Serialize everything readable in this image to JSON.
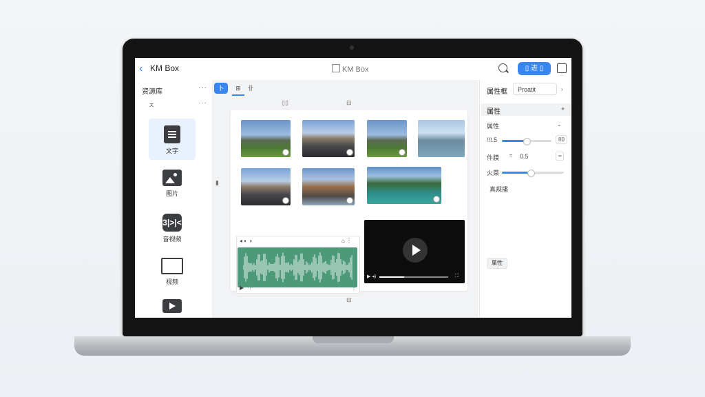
{
  "header": {
    "back_icon": "chevron-left-icon",
    "app_title": "KM Box",
    "center_title": "KM Box",
    "primary_button": "▯ 进 ▯",
    "search_icon": "search-icon",
    "share_icon": "share-icon",
    "accent_color": "#3a86ef"
  },
  "sidebar": {
    "title": "资源库",
    "more": "···",
    "sub": "ㅈ",
    "items": [
      {
        "label": "文字",
        "icon": "document-icon"
      },
      {
        "label": "图片",
        "icon": "image-icon"
      },
      {
        "label": "音视频",
        "icon": "audio-icon",
        "glyph": "3|>|<"
      },
      {
        "label": "视频",
        "icon": "monitor-icon"
      },
      {
        "label": "",
        "icon": "video-icon"
      }
    ]
  },
  "canvas": {
    "toolbar": [
      "卜",
      "⊞",
      "卝"
    ],
    "top_icons": [
      "▯▯",
      "⊟"
    ],
    "bottom_icon": "⊟",
    "side_icon": "▮",
    "audio": {
      "controls_left": "◂ ◐ ◑",
      "controls_right": "⌂ ⋮",
      "play": "▶",
      "time": "·/·",
      "more": "⋮"
    },
    "video": {
      "play_icon": "play-icon",
      "controls": "▶ ◂)"
    }
  },
  "panel": {
    "title": "属性框",
    "select": "Proatit",
    "section": "属性",
    "section_icon": "⌖",
    "rows": [
      {
        "label": "属性",
        "value": ""
      },
      {
        "label": "!!!.5",
        "value": "80"
      },
      {
        "label": "件膜",
        "chip1": "≈",
        "value": "0.5",
        "chip2": "≈"
      },
      {
        "label": "火菜",
        "value": ""
      },
      {
        "label": "真规播",
        "value": ""
      }
    ],
    "opacity_slider": 0.48,
    "scale_slider": 0.45,
    "button": "属性"
  }
}
